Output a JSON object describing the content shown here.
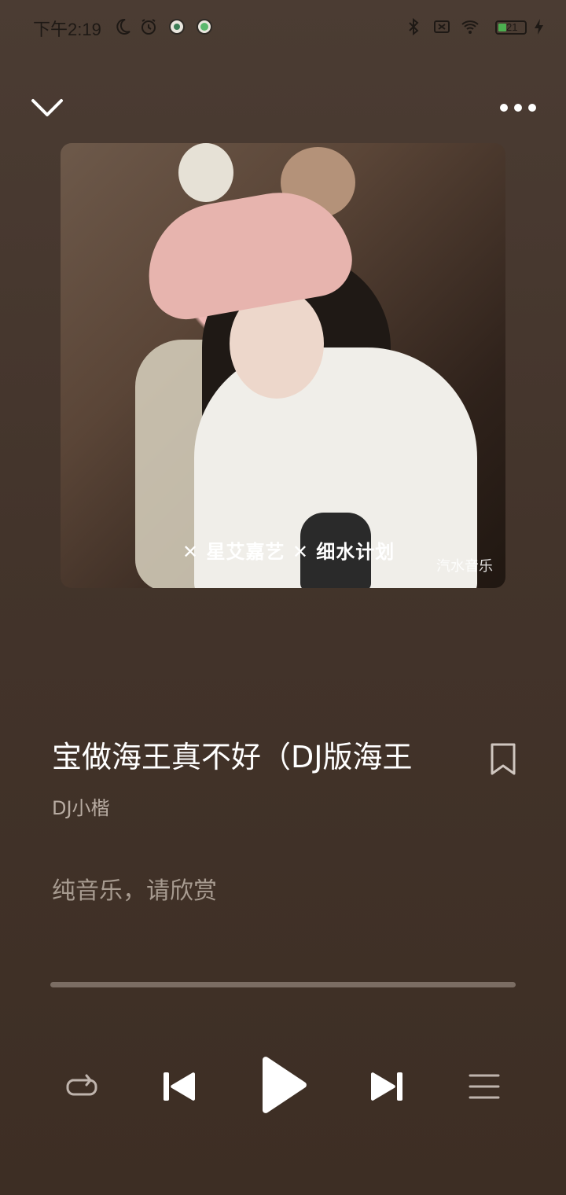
{
  "status_bar": {
    "time": "下午2:19",
    "battery_level": "21",
    "icons": [
      "moon-icon",
      "alarm-icon",
      "app-notification-icon",
      "app-notification-icon-2",
      "bluetooth-icon",
      "sim-off-icon",
      "wifi-icon",
      "battery-icon",
      "charging-icon"
    ]
  },
  "header": {
    "collapse_icon": "chevron-down-icon",
    "more_icon": "more-dots-icon"
  },
  "album": {
    "overlay_text": "✕ 星艾嘉艺 ✕ 细水计划",
    "watermark": "汽水音乐"
  },
  "song": {
    "title": "宝做海王真不好（DJ版海王",
    "artist": "DJ小楷",
    "lyrics_placeholder": "纯音乐，请欣赏"
  },
  "player": {
    "progress": 0.0,
    "controls": [
      "repeat-icon",
      "previous-icon",
      "play-icon",
      "next-icon",
      "queue-icon"
    ]
  },
  "colors": {
    "background": "#43342b",
    "text_primary": "#ffffff",
    "text_secondary": "#b7aba1",
    "progress_track": "#7b6d63"
  }
}
